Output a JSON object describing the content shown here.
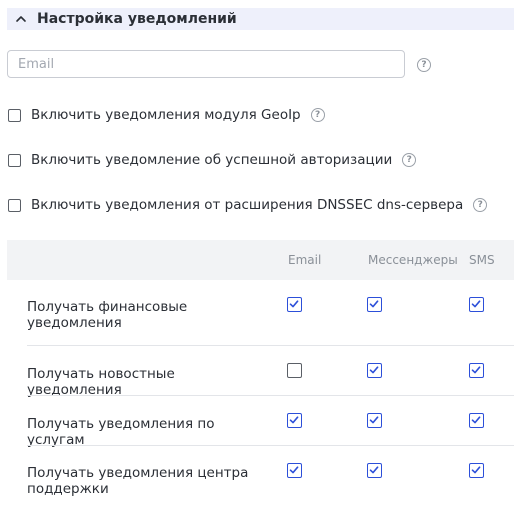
{
  "section": {
    "title": "Настройка уведомлений",
    "expanded": true
  },
  "email": {
    "placeholder": "Email",
    "value": ""
  },
  "help_glyph": "?",
  "options": [
    {
      "label": "Включить уведомления модуля GeoIp",
      "checked": false
    },
    {
      "label": "Включить уведомление об успешной авторизации",
      "checked": false
    },
    {
      "label": "Включить уведомления от расширения DNSSEC dns-сервера",
      "checked": false
    }
  ],
  "table": {
    "columns": [
      "Email",
      "Мессенджеры",
      "SMS"
    ],
    "rows": [
      {
        "label": "Получать финансовые уведомления",
        "email": true,
        "messengers": true,
        "sms": true
      },
      {
        "label": "Получать новостные уведомления",
        "email": false,
        "messengers": true,
        "sms": true
      },
      {
        "label": "Получать уведомления по услугам",
        "email": true,
        "messengers": true,
        "sms": true
      },
      {
        "label": "Получать уведомления центра поддержки",
        "email": true,
        "messengers": true,
        "sms": true
      }
    ]
  },
  "colors": {
    "accent": "#2c4fd9",
    "header_bg": "#eef0fb",
    "table_head_bg": "#f2f3f5"
  }
}
